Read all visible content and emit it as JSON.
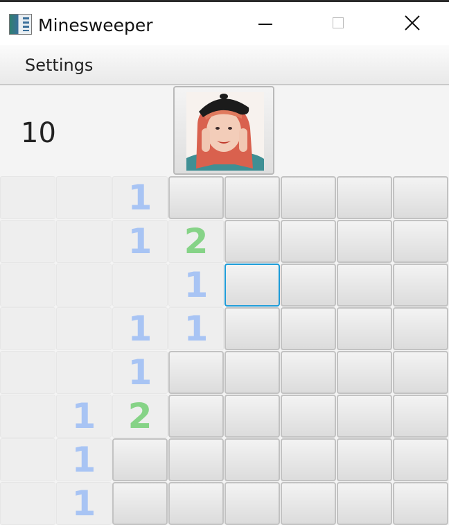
{
  "window": {
    "title": "Minesweeper",
    "icon": "minesweeper-app-icon",
    "controls": [
      "minimize",
      "maximize",
      "close"
    ]
  },
  "menu": {
    "items": [
      "Settings"
    ]
  },
  "header": {
    "mine_counter": "10",
    "face_button_image": "avatar-photo"
  },
  "board": {
    "rows": 8,
    "cols": 8,
    "focused_cell": [
      2,
      4
    ],
    "number_colors": {
      "1": "#a8c4f4",
      "2": "#86d387"
    },
    "cells": [
      [
        "open",
        "open",
        "1",
        "covered",
        "covered",
        "covered",
        "covered",
        "covered"
      ],
      [
        "open",
        "open",
        "1",
        "2",
        "covered",
        "covered",
        "covered",
        "covered"
      ],
      [
        "open",
        "open",
        "open",
        "1",
        "covered",
        "covered",
        "covered",
        "covered"
      ],
      [
        "open",
        "open",
        "1",
        "1",
        "covered",
        "covered",
        "covered",
        "covered"
      ],
      [
        "open",
        "open",
        "1",
        "covered",
        "covered",
        "covered",
        "covered",
        "covered"
      ],
      [
        "open",
        "1",
        "2",
        "covered",
        "covered",
        "covered",
        "covered",
        "covered"
      ],
      [
        "open",
        "1",
        "covered",
        "covered",
        "covered",
        "covered",
        "covered",
        "covered"
      ],
      [
        "open",
        "1",
        "covered",
        "covered",
        "covered",
        "covered",
        "covered",
        "covered"
      ]
    ]
  }
}
